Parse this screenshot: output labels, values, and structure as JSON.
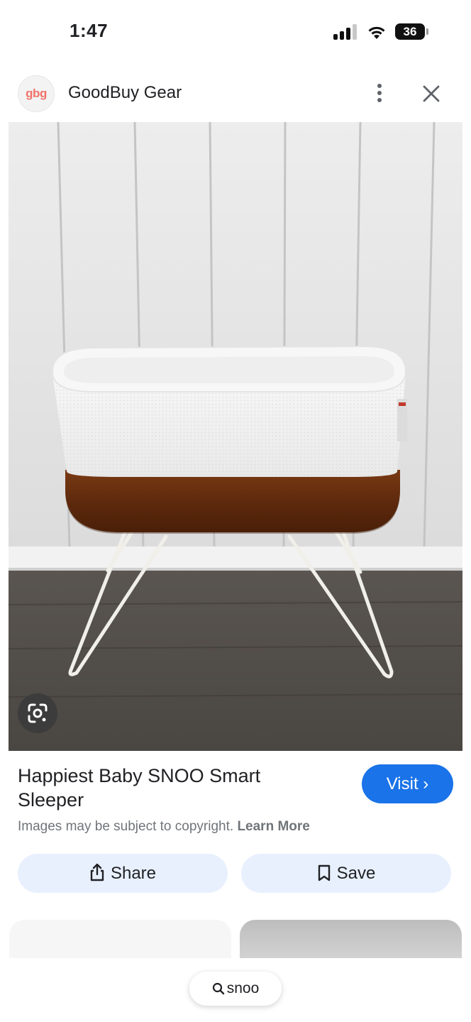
{
  "status_bar": {
    "time": "1:47",
    "battery": "36"
  },
  "header": {
    "logo_text": "gbg",
    "site_name": "GoodBuy Gear"
  },
  "product": {
    "title": "Happiest Baby SNOO Smart Sleeper",
    "visit_label": "Visit ›",
    "copyright_text": "Images may be subject to copyright.",
    "learn_more_label": "Learn More"
  },
  "actions": {
    "share_label": "Share",
    "save_label": "Save"
  },
  "search": {
    "query": "snoo"
  },
  "icons": {
    "menu": "more-vert-icon",
    "close": "close-icon",
    "lens": "google-lens-icon",
    "share": "share-icon",
    "save": "bookmark-icon",
    "search": "search-icon"
  },
  "colors": {
    "accent": "#1a73e8",
    "chip_bg": "#e8f0fe",
    "logo": "#f0736a"
  }
}
